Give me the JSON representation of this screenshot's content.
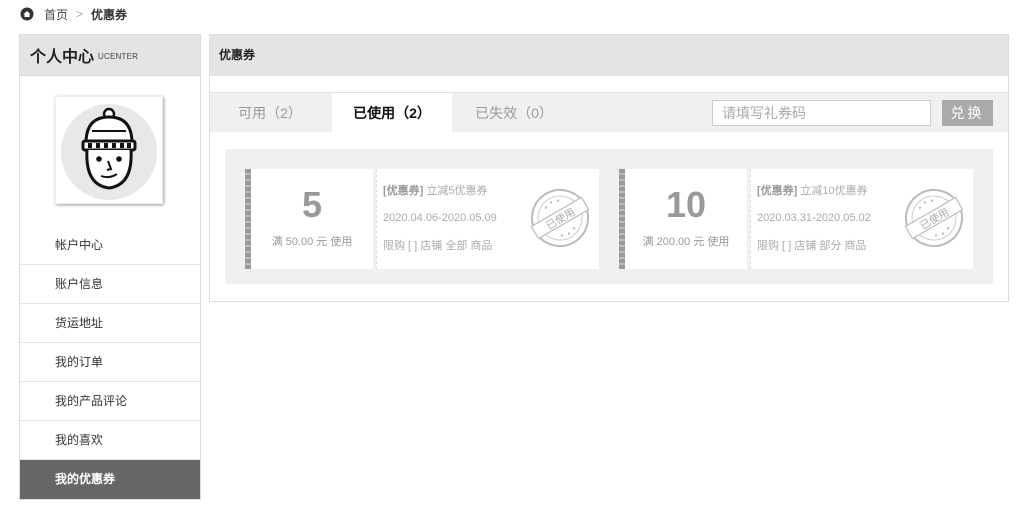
{
  "breadcrumb": {
    "home": "首页",
    "sep": ">",
    "current": "优惠券"
  },
  "sidebar": {
    "title": "个人中心",
    "title_en": "UCENTER",
    "items": [
      {
        "label": "帐户中心"
      },
      {
        "label": "账户信息"
      },
      {
        "label": "货运地址"
      },
      {
        "label": "我的订单"
      },
      {
        "label": "我的产品评论"
      },
      {
        "label": "我的喜欢"
      },
      {
        "label": "我的优惠券"
      }
    ]
  },
  "main": {
    "title": "优惠券",
    "tabs": [
      {
        "label": "可用（2）"
      },
      {
        "label": "已使用（2）"
      },
      {
        "label": "已失效（0）"
      }
    ],
    "code_placeholder": "请填写礼券码",
    "redeem_label": "兑换",
    "coupons": [
      {
        "amount": "5",
        "condition": "满 50.00 元 使用",
        "tag": "[优惠券]",
        "name": "立减5优惠券",
        "dates": "2020.04.06-2020.05.09",
        "scope": "限购 [ ] 店铺 全部 商品",
        "stamp": "已使用"
      },
      {
        "amount": "10",
        "condition": "满 200.00 元 使用",
        "tag": "[优惠券]",
        "name": "立减10优惠券",
        "dates": "2020.03.31-2020.05.02",
        "scope": "限购 [ ] 店铺 部分 商品",
        "stamp": "已使用"
      }
    ]
  }
}
